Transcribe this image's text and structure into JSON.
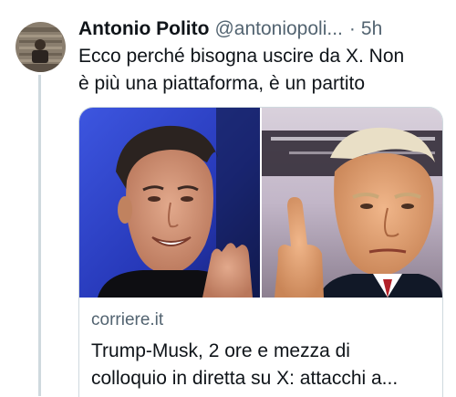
{
  "tweet": {
    "author": {
      "display_name": "Antonio Polito",
      "handle": "@antoniopoli...",
      "avatar_icon": "user-avatar"
    },
    "separator": "·",
    "timestamp": "5h",
    "text_line1": "Ecco perché bisogna uscire da X. Non",
    "text_line2": "è più una piattaforma, è un partito"
  },
  "link_card": {
    "image_description_icon": "news-photo",
    "domain": "corriere.it",
    "title_line1": "Trump-Musk, 2 ore e mezza di",
    "title_line2": "colloquio in diretta su X: attacchi a..."
  },
  "colors": {
    "text_primary": "#0f1419",
    "text_secondary": "#536471",
    "border": "#cfd9de",
    "thread_line": "#cfd9de"
  }
}
